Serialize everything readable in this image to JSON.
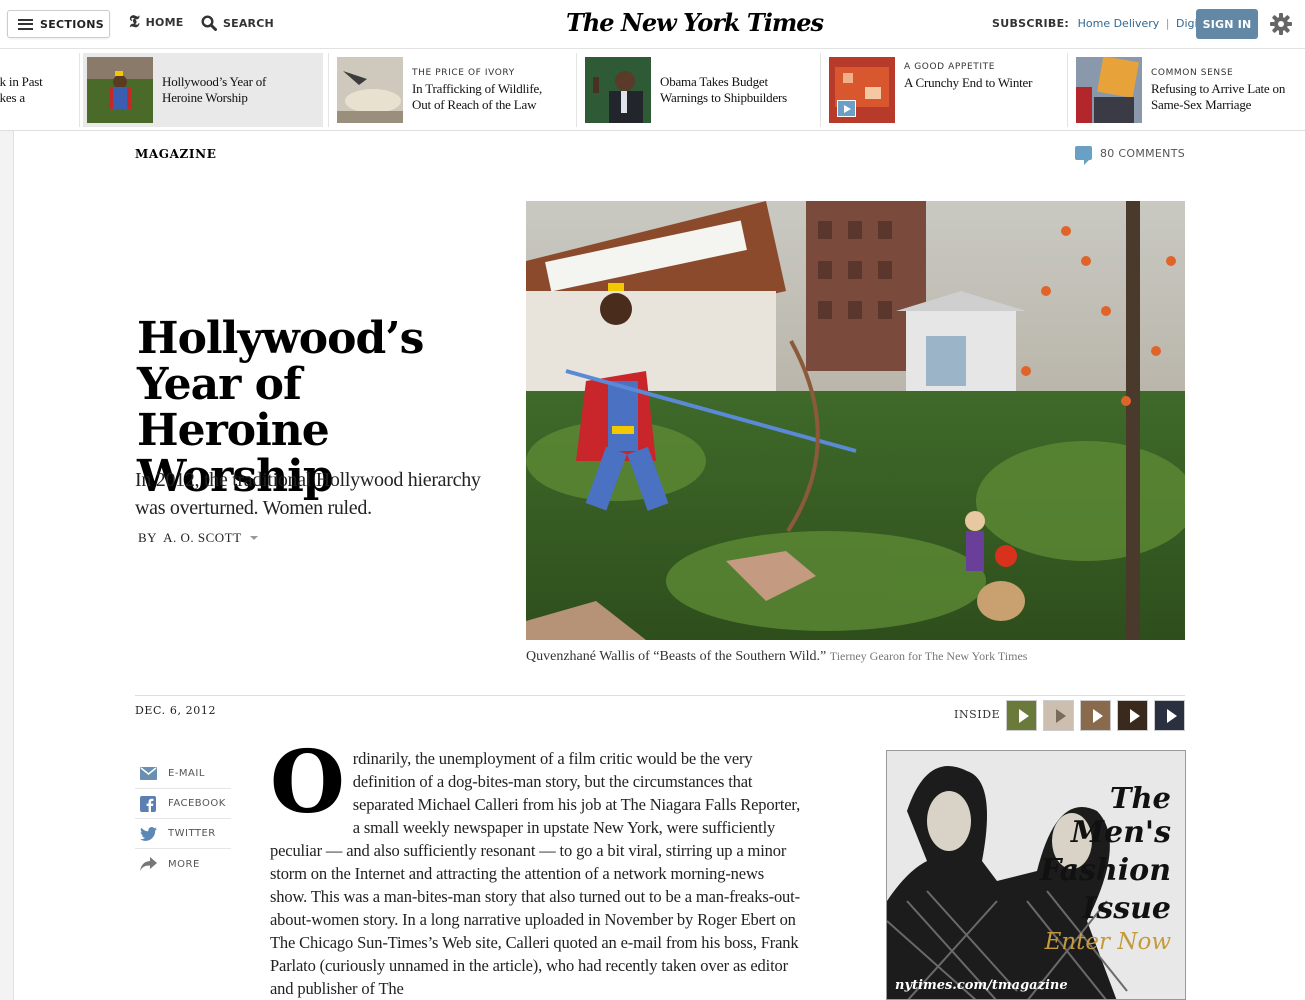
{
  "header": {
    "sections_label": "SECTIONS",
    "home_label": "HOME",
    "search_label": "SEARCH",
    "logo_text": "The New York Times",
    "subscribe_label": "SUBSCRIBE:",
    "home_delivery": "Home Delivery",
    "divider": "|",
    "digital": "Digital",
    "sign_in": "SIGN IN"
  },
  "ribbon": {
    "items": [
      {
        "kicker": "",
        "title": "ak in Past\nakes a"
      },
      {
        "kicker": "",
        "title": "Hollywood’s Year of Heroine Worship"
      },
      {
        "kicker": "THE PRICE OF IVORY",
        "title": "In Trafficking of Wildlife, Out of Reach of the Law"
      },
      {
        "kicker": "",
        "title": "Obama Takes Budget Warnings to Shipbuilders"
      },
      {
        "kicker": "A GOOD APPETITE",
        "title": "A Crunchy End to Winter"
      },
      {
        "kicker": "COMMON SENSE",
        "title": "Refusing to Arrive Late on Same-Sex Marriage"
      }
    ]
  },
  "article": {
    "kicker": "MAGAZINE",
    "comments": "80 COMMENTS",
    "headline": "Hollywood’s Year of Heroine Worship",
    "summary": "In 2012, the traditional Hollywood hierarchy was overturned. Women ruled.",
    "byline_prefix": "BY",
    "byline_author": "A. O. SCOTT",
    "caption": "Quvenzhané Wallis of “Beasts of the Southern Wild.”",
    "credit": "Tierney Gearon for The New York Times",
    "date": "DEC. 6, 2012",
    "inside_label": "INSIDE",
    "dropcap": "O",
    "body_text": "rdinarily, the unemployment of a film critic would be the very definition of a dog-bites-man story, but the circumstances that separated Michael Calleri from his job at The Niagara Falls Reporter, a small weekly newspaper in upstate New York, were sufficiently peculiar — and also sufficiently resonant — to go a bit viral, stirring up a minor storm on the Internet and attracting the attention of a network morning-news show. This was a man-bites-man story that also turned out to be a man-freaks-out-about-women story. In a long narrative uploaded in November by Roger Ebert on The Chicago Sun-Times’s Web site, Calleri quoted an e-mail from his boss, Frank Parlato (curiously unnamed in the article), who had recently taken over as editor and publisher of The"
  },
  "share": {
    "email": "E-MAIL",
    "facebook": "FACEBOOK",
    "twitter": "TWITTER",
    "more": "MORE"
  },
  "ad": {
    "line1": "The",
    "line2": "Men's",
    "line3": "Fashion",
    "line4": "Issue",
    "cta": "Enter Now",
    "url": "nytimes.com/tmagazine"
  },
  "colors": {
    "link_blue": "#326891",
    "signin_bg": "#6288a5",
    "comment_bubble": "#6a9fc6"
  }
}
